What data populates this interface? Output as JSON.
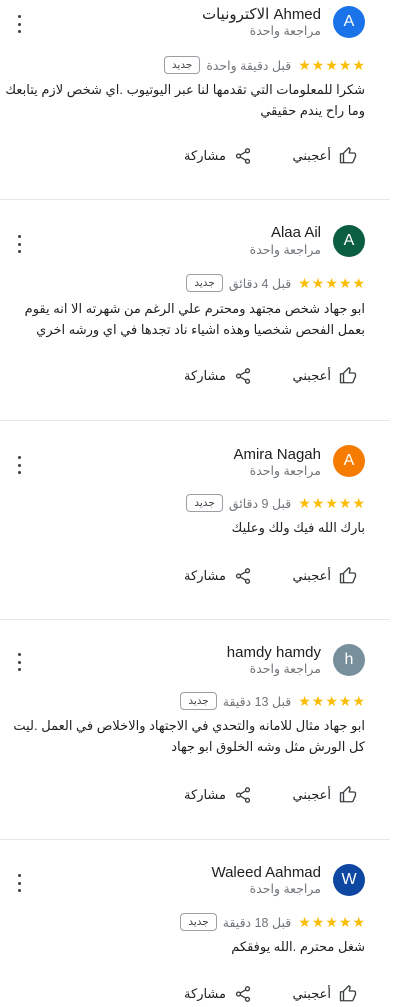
{
  "labels": {
    "like": "أعجبني",
    "share": "مشاركة",
    "new_badge": "جديد"
  },
  "reviews": [
    {
      "name": "Ahmed الاكترونيات",
      "sub": "مراجعة واحدة",
      "initial": "A",
      "avatar_color": "#1a73e8",
      "rating": 5,
      "time": "قبل دقيقة واحدة",
      "badge": "جديد",
      "text": "شكرا للمعلومات التي تقدمها لنا عبر اليوتيوب .اي شخص لازم يتابعك وما راح يندم حقيقي"
    },
    {
      "name": "Alaa Ail",
      "sub": "مراجعة واحدة",
      "initial": "A",
      "avatar_color": "#0b5e42",
      "rating": 5,
      "time": "قبل 4 دقائق",
      "badge": "جديد",
      "text": "ابو جهاد شخص مجتهد ومحترم علي الرغم من شهرته الا انه يقوم بعمل الفحص شخصيا وهذه اشياء ناد تجدها في اي ورشه اخري"
    },
    {
      "name": "Amira Nagah",
      "sub": "مراجعة واحدة",
      "initial": "A",
      "avatar_color": "#f57c00",
      "rating": 5,
      "time": "قبل 9 دقائق",
      "badge": "جديد",
      "text": "بارك الله فيك ولك وعليك"
    },
    {
      "name": "hamdy hamdy",
      "sub": "مراجعة واحدة",
      "initial": "h",
      "avatar_color": "#78909c",
      "rating": 5,
      "time": "قبل 13 دقيقة",
      "badge": "جديد",
      "text": "ابو جهاد مثال للامانه والتحدي في الاجتهاد والاخلاص في العمل .ليت كل الورش مثل وشه الخلوق ابو جهاد"
    },
    {
      "name": "Waleed Aahmad",
      "sub": "مراجعة واحدة",
      "initial": "W",
      "avatar_color": "#0d47a1",
      "rating": 5,
      "time": "قبل 18 دقيقة",
      "badge": "جديد",
      "text": "شغل محترم .الله يوفقكم"
    }
  ]
}
